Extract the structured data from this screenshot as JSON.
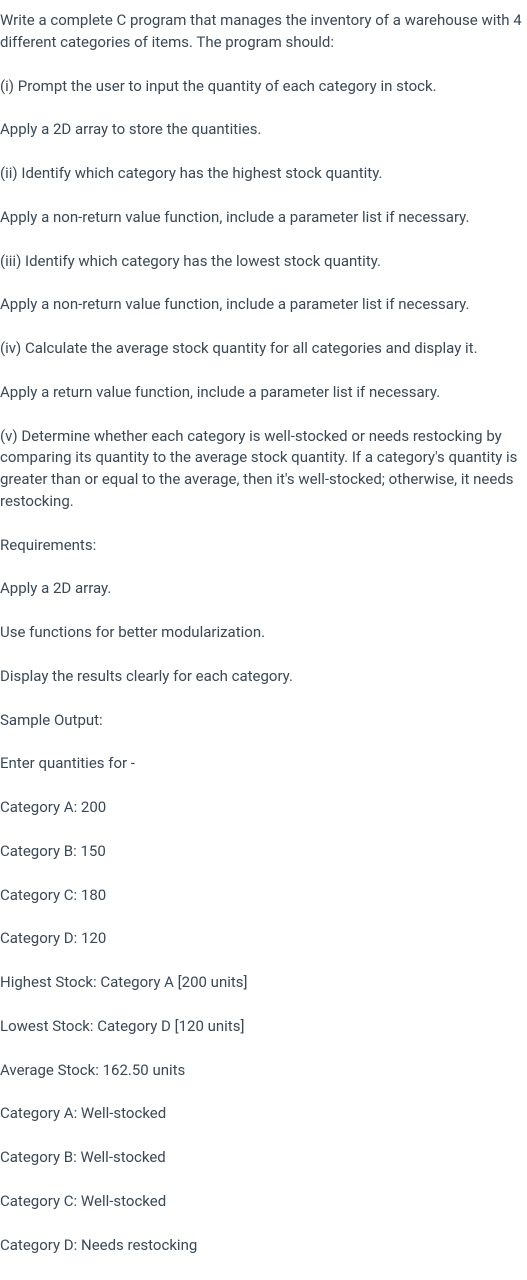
{
  "paragraphs": [
    "Write a complete C program that manages the inventory of a warehouse with 4 different categories of items. The program should:",
    "(i) Prompt the user to input the quantity of each category in stock.",
    "Apply a 2D array to store the quantities.",
    "(ii) Identify which category has the highest stock quantity.",
    "Apply a non-return value function, include a parameter list if necessary.",
    "(iii) Identify which category has the lowest stock quantity.",
    "Apply a non-return value function, include a parameter list if necessary.",
    "(iv) Calculate the average stock quantity for all categories and display it.",
    "Apply a return value function, include a parameter list if necessary.",
    "(v) Determine whether each category is well-stocked or needs restocking by comparing its quantity to the average stock quantity. If a category's quantity is greater than or equal to the average, then it's well-stocked; otherwise, it needs restocking.",
    "Requirements:",
    "Apply a 2D array.",
    "Use functions for better modularization.",
    "Display the results clearly for each category.",
    "Sample Output:",
    "Enter quantities for -",
    "Category A: 200",
    "Category B: 150",
    "Category C: 180",
    "Category D: 120",
    "Highest Stock: Category A [200 units]",
    "Lowest Stock: Category D [120 units]",
    "Average Stock: 162.50 units",
    "Category A: Well-stocked",
    "Category B: Well-stocked",
    "Category C: Well-stocked",
    "Category D: Needs restocking"
  ]
}
